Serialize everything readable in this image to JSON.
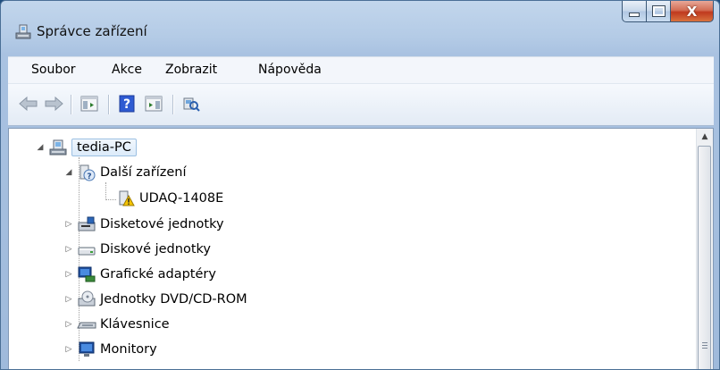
{
  "window": {
    "title": "Správce zařízení",
    "close_glyph": "X"
  },
  "menu": {
    "items": [
      "Soubor",
      "Akce",
      "Zobrazit",
      "Nápověda"
    ]
  },
  "toolbar": {
    "buttons": [
      "back-arrow-icon",
      "forward-arrow-icon",
      "show-hide-console-tree-icon",
      "help-icon",
      "show-hide-action-pane-icon",
      "scan-hardware-icon"
    ]
  },
  "tree": {
    "root": "tedia-PC",
    "nodes": [
      {
        "label": "Další zařízení",
        "expanded": true
      },
      {
        "label": "UDAQ-1408E",
        "warning": true
      },
      {
        "label": "Disketové jednotky"
      },
      {
        "label": "Diskové jednotky"
      },
      {
        "label": "Grafické adaptéry"
      },
      {
        "label": "Jednotky DVD/CD-ROM"
      },
      {
        "label": "Klávesnice"
      },
      {
        "label": "Monitory"
      }
    ]
  },
  "colors": {
    "selection_border": "#9cc0e2",
    "warning": "#f5c400",
    "close_button": "#c0391e"
  }
}
